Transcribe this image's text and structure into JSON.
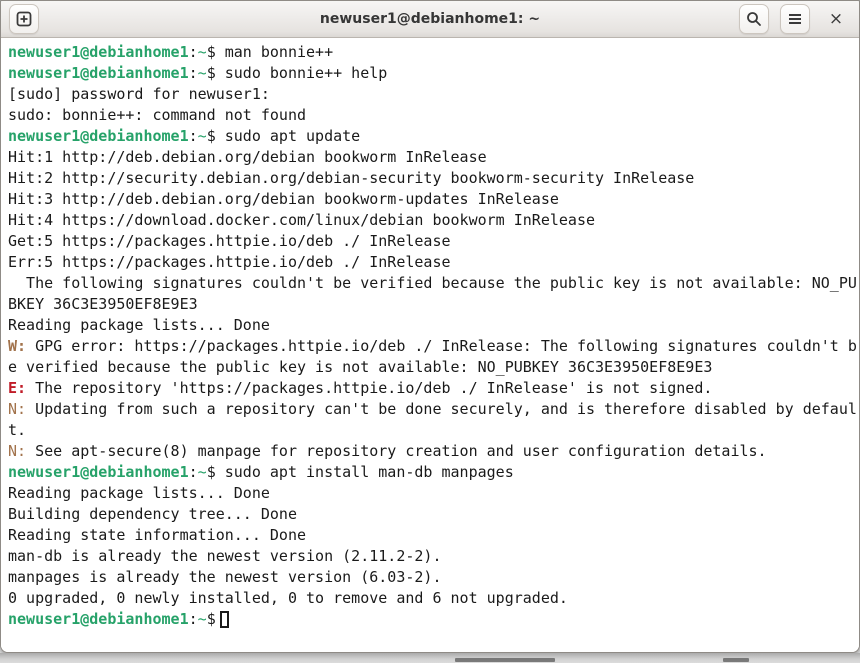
{
  "window": {
    "title": "newuser1@debianhome1: ~"
  },
  "titlebar": {
    "icons": [
      "new-tab-icon",
      "search-icon",
      "menu-icon",
      "close-icon"
    ],
    "close_glyph": "×"
  },
  "colors": {
    "terminal_bg": "#ffffff",
    "terminal_fg": "#1a1a1a",
    "prompt_green": "#26a269",
    "warning_brown": "#a2734c",
    "error_red": "#c01c28",
    "headerbar_bg": "#ebe8e5"
  },
  "terminal": {
    "prompt": {
      "user_host": "newuser1@debianhome1",
      "separator": ":",
      "path": "~",
      "dollar": "$ "
    },
    "lines": [
      [
        {
          "t": "newuser1@debianhome1",
          "s": "prompt"
        },
        {
          "t": ":",
          "s": "fg"
        },
        {
          "t": "~",
          "s": "path"
        },
        {
          "t": "$ ",
          "s": "fg"
        },
        {
          "t": "man bonnie++",
          "s": "fg"
        }
      ],
      [
        {
          "t": "newuser1@debianhome1",
          "s": "prompt"
        },
        {
          "t": ":",
          "s": "fg"
        },
        {
          "t": "~",
          "s": "path"
        },
        {
          "t": "$ ",
          "s": "fg"
        },
        {
          "t": "sudo bonnie++ help",
          "s": "fg"
        }
      ],
      [
        {
          "t": "[sudo] password for newuser1:",
          "s": "fg"
        }
      ],
      [
        {
          "t": "sudo: bonnie++: command not found",
          "s": "fg"
        }
      ],
      [
        {
          "t": "newuser1@debianhome1",
          "s": "prompt"
        },
        {
          "t": ":",
          "s": "fg"
        },
        {
          "t": "~",
          "s": "path"
        },
        {
          "t": "$ ",
          "s": "fg"
        },
        {
          "t": "sudo apt update",
          "s": "fg"
        }
      ],
      [
        {
          "t": "Hit:1 http://deb.debian.org/debian bookworm InRelease",
          "s": "fg"
        }
      ],
      [
        {
          "t": "Hit:2 http://security.debian.org/debian-security bookworm-security InRelease",
          "s": "fg"
        }
      ],
      [
        {
          "t": "Hit:3 http://deb.debian.org/debian bookworm-updates InRelease",
          "s": "fg"
        }
      ],
      [
        {
          "t": "Hit:4 https://download.docker.com/linux/debian bookworm InRelease",
          "s": "fg"
        }
      ],
      [
        {
          "t": "Get:5 https://packages.httpie.io/deb ./ InRelease",
          "s": "fg"
        }
      ],
      [
        {
          "t": "Err:5 https://packages.httpie.io/deb ./ InRelease",
          "s": "fg"
        }
      ],
      [
        {
          "t": "  The following signatures couldn't be verified because the public key is not available: NO_PU",
          "s": "fg"
        }
      ],
      [
        {
          "t": "BKEY 36C3E3950EF8E9E3",
          "s": "fg"
        }
      ],
      [
        {
          "t": "Reading package lists... Done",
          "s": "fg"
        }
      ],
      [
        {
          "t": "W:",
          "s": "warn"
        },
        {
          "t": " GPG error: https://packages.httpie.io/deb ./ InRelease: The following signatures couldn't b",
          "s": "fg"
        }
      ],
      [
        {
          "t": "e verified because the public key is not available: NO_PUBKEY 36C3E3950EF8E9E3",
          "s": "fg"
        }
      ],
      [
        {
          "t": "E:",
          "s": "err"
        },
        {
          "t": " The repository 'https://packages.httpie.io/deb ./ InRelease' is not signed.",
          "s": "fg"
        }
      ],
      [
        {
          "t": "N:",
          "s": "note"
        },
        {
          "t": " Updating from such a repository can't be done securely, and is therefore disabled by defaul",
          "s": "fg"
        }
      ],
      [
        {
          "t": "t.",
          "s": "fg"
        }
      ],
      [
        {
          "t": "N:",
          "s": "note"
        },
        {
          "t": " See apt-secure(8) manpage for repository creation and user configuration details.",
          "s": "fg"
        }
      ],
      [
        {
          "t": "newuser1@debianhome1",
          "s": "prompt"
        },
        {
          "t": ":",
          "s": "fg"
        },
        {
          "t": "~",
          "s": "path"
        },
        {
          "t": "$ ",
          "s": "fg"
        },
        {
          "t": "sudo apt install man-db manpages",
          "s": "fg"
        }
      ],
      [
        {
          "t": "Reading package lists... Done",
          "s": "fg"
        }
      ],
      [
        {
          "t": "Building dependency tree... Done",
          "s": "fg"
        }
      ],
      [
        {
          "t": "Reading state information... Done",
          "s": "fg"
        }
      ],
      [
        {
          "t": "man-db is already the newest version (2.11.2-2).",
          "s": "fg"
        }
      ],
      [
        {
          "t": "manpages is already the newest version (6.03-2).",
          "s": "fg"
        }
      ],
      [
        {
          "t": "0 upgraded, 0 newly installed, 0 to remove and 6 not upgraded.",
          "s": "fg"
        }
      ],
      [
        {
          "t": "newuser1@debianhome1",
          "s": "prompt"
        },
        {
          "t": ":",
          "s": "fg"
        },
        {
          "t": "~",
          "s": "path"
        },
        {
          "t": "$",
          "s": "fg"
        },
        {
          "t": "",
          "s": "fg",
          "cursor": true
        }
      ]
    ]
  }
}
